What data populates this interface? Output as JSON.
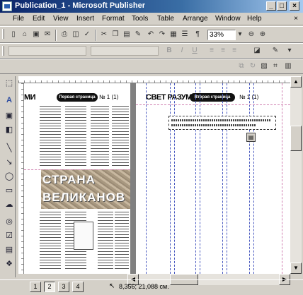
{
  "window": {
    "title": "Publication_1 - Microsoft Publisher",
    "minimize": "_",
    "maximize": "□",
    "close": "×"
  },
  "menu": {
    "items": [
      "File",
      "Edit",
      "View",
      "Insert",
      "Format",
      "Tools",
      "Table",
      "Arrange",
      "Window",
      "Help"
    ],
    "close": "×"
  },
  "toolbar": {
    "zoom_value": "33%",
    "icons": [
      "new-icon",
      "open-icon",
      "save-icon",
      "email-icon",
      "print-icon",
      "print-preview-icon",
      "spelling-icon",
      "cut-icon",
      "copy-icon",
      "paste-icon",
      "format-painter-icon",
      "undo-icon",
      "redo-icon",
      "bring-front-icon",
      "send-back-icon",
      "insert-table-icon",
      "columns-icon",
      "pilcrow-icon",
      "zoom-out-icon",
      "zoom-in-icon"
    ]
  },
  "palette": {
    "icons": [
      "select-icon",
      "text-box-icon",
      "picture-frame-icon",
      "wordart-icon",
      "line-icon",
      "arrow-icon",
      "oval-icon",
      "rectangle-icon",
      "autoshapes-icon",
      "hot-spot-icon",
      "form-control-icon",
      "html-code-icon",
      "design-gallery-icon"
    ]
  },
  "document": {
    "left_header": "МИ",
    "left_pill": "Первая страница",
    "left_page_num": "№ 1 (1)",
    "big_title_1": "СТРАНА",
    "big_title_2": "ВЕЛИКАНОВ",
    "right_header": "СВЕТ РАЗУМА",
    "right_pill": "Вторая страница",
    "right_page_num": "№ 1 (1)"
  },
  "status": {
    "pages": [
      "1",
      "2",
      "3",
      "4"
    ],
    "active_page": "2",
    "coords": "8,356; 21,088 см."
  }
}
